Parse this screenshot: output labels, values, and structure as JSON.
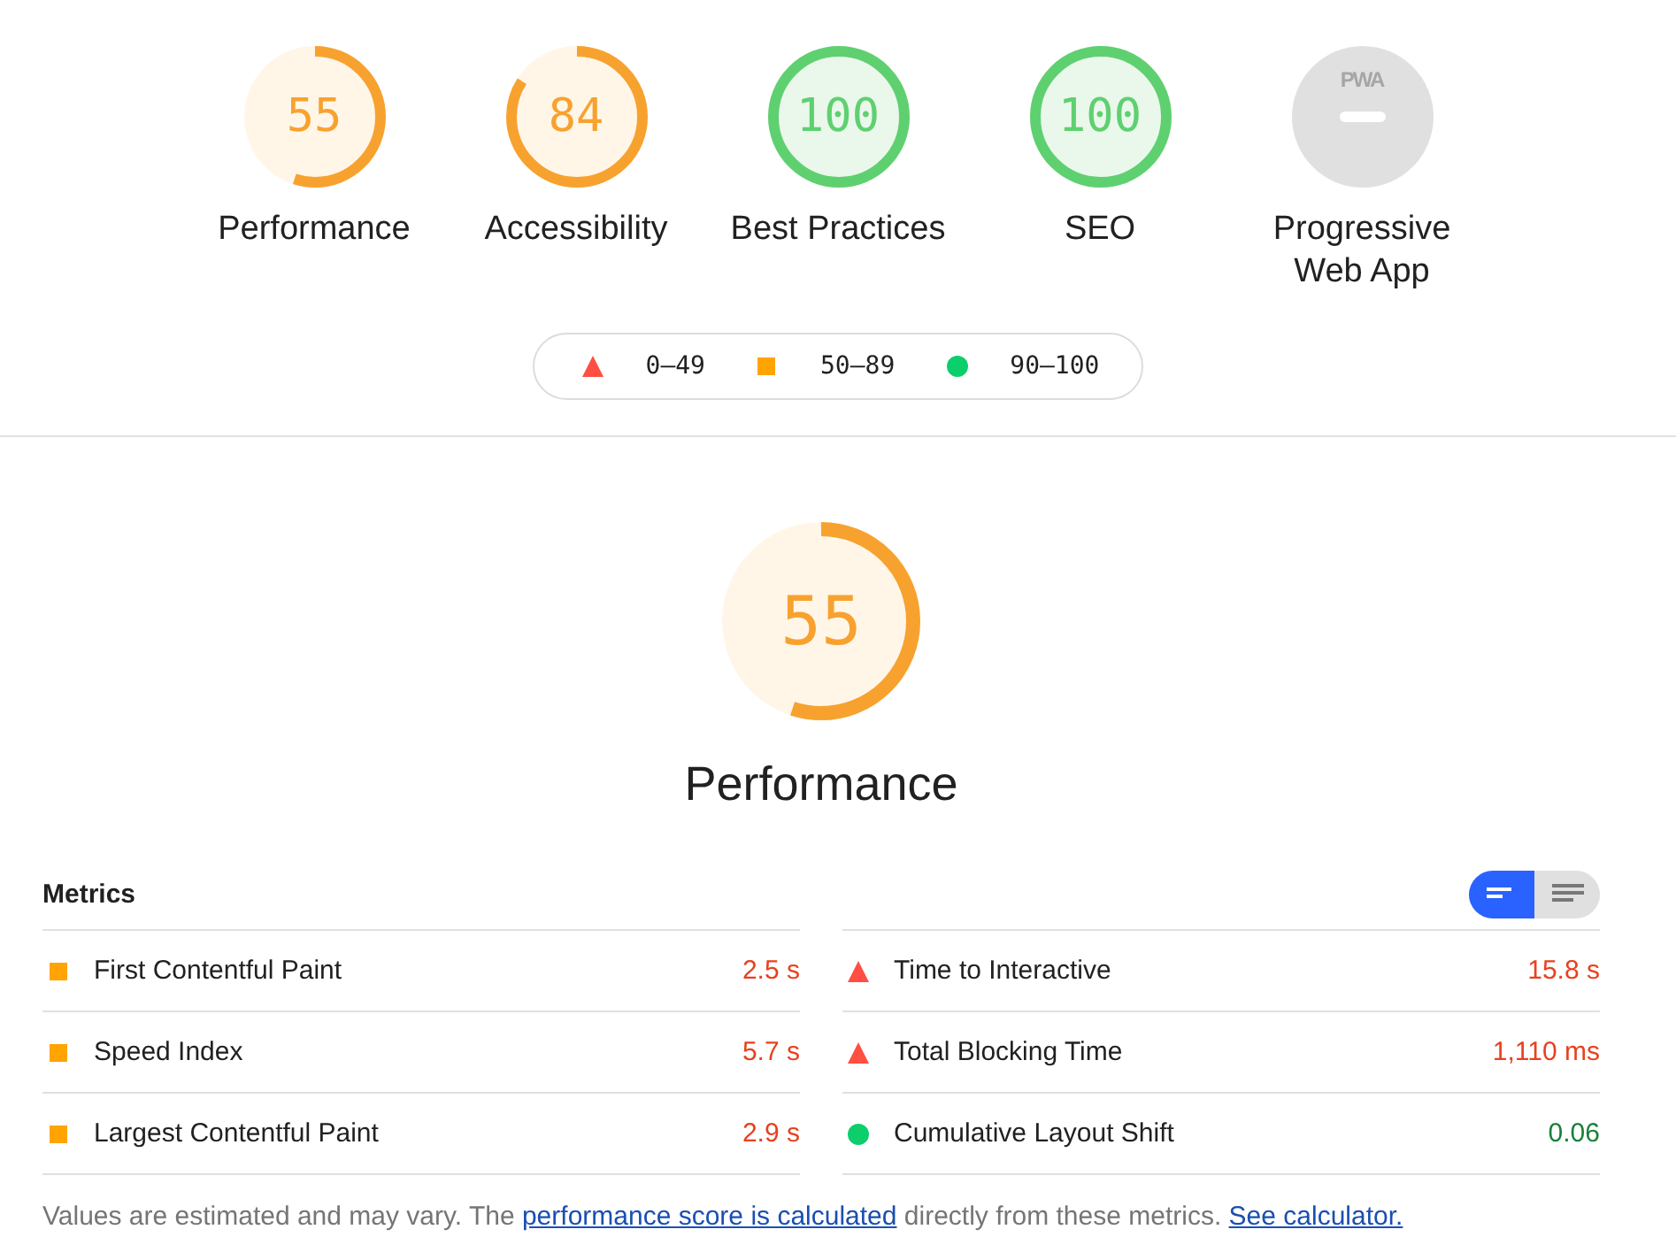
{
  "gauges": [
    {
      "score": "55",
      "label": "Performance",
      "kind": "average"
    },
    {
      "score": "84",
      "label": "Accessibility",
      "kind": "average"
    },
    {
      "score": "100",
      "label": "Best Practices",
      "kind": "pass"
    },
    {
      "score": "100",
      "label": "SEO",
      "kind": "pass"
    },
    {
      "badge": "PWA",
      "label": "Progressive Web App",
      "kind": "na"
    }
  ],
  "legend": [
    {
      "kind": "fail",
      "range": "0–49"
    },
    {
      "kind": "average",
      "range": "50–89"
    },
    {
      "kind": "pass",
      "range": "90–100"
    }
  ],
  "main_gauge": {
    "score": "55",
    "label": "Performance",
    "kind": "average"
  },
  "metrics": {
    "title": "Metrics",
    "view_toggle": [
      {
        "kind": "compact",
        "selected": true
      },
      {
        "kind": "expanded",
        "selected": false
      }
    ],
    "items": [
      {
        "name": "First Contentful Paint",
        "value": "2.5 s",
        "kind": "average"
      },
      {
        "name": "Time to Interactive",
        "value": "15.8 s",
        "kind": "fail"
      },
      {
        "name": "Speed Index",
        "value": "5.7 s",
        "kind": "average"
      },
      {
        "name": "Total Blocking Time",
        "value": "1,110 ms",
        "kind": "fail"
      },
      {
        "name": "Largest Contentful Paint",
        "value": "2.9 s",
        "kind": "average"
      },
      {
        "name": "Cumulative Layout Shift",
        "value": "0.06",
        "kind": "pass"
      }
    ]
  },
  "note": [
    {
      "kind": "text",
      "text": "Values are estimated and may vary. The "
    },
    {
      "kind": "link",
      "text": "performance score is calculated"
    },
    {
      "kind": "text",
      "text": " directly from these metrics. "
    },
    {
      "kind": "link",
      "text": "See calculator."
    }
  ]
}
